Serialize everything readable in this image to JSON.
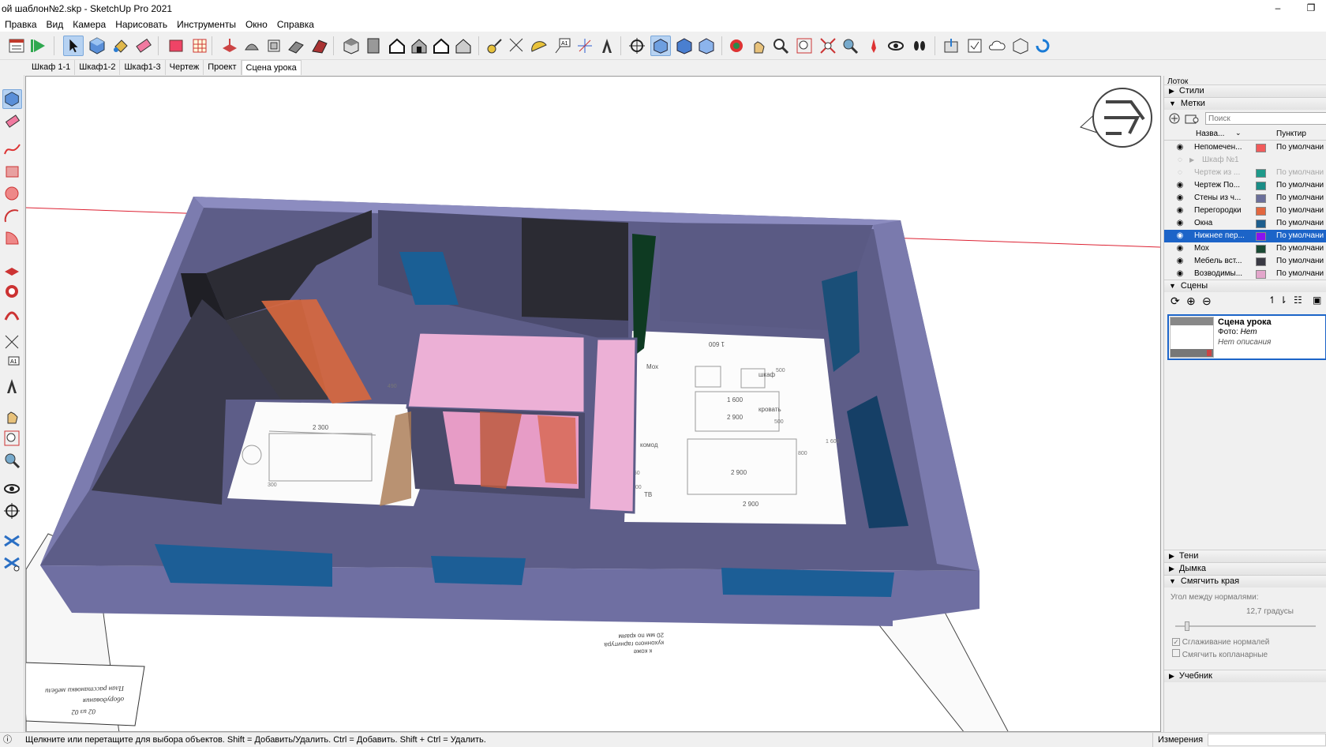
{
  "window": {
    "title": "ой шаблон№2.skp - SketchUp Pro 2021",
    "minimize": "–",
    "restore": "❐"
  },
  "menu": [
    "Правка",
    "Вид",
    "Камера",
    "Нарисовать",
    "Инструменты",
    "Окно",
    "Справка"
  ],
  "tabs": [
    "Шкаф 1-1",
    "Шкаф1-2",
    "Шкаф1-3",
    "Чертеж",
    "Проект",
    "Сцена урока"
  ],
  "active_tab": "Сцена урока",
  "drawing": {
    "dims": [
      "1 600",
      "2 900",
      "1 600",
      "2 300",
      "2 900",
      "1 600",
      "500",
      "800",
      "450",
      "490",
      "500",
      "200",
      "300"
    ],
    "labels": [
      "шкаф",
      "Мох",
      "комод",
      "ТВ",
      "кровать",
      "2 900"
    ],
    "plan_sheet": [
      "План расстановки мебели",
      "оборудования",
      "02 из 02"
    ],
    "bottom_note": [
      "20 мм по краям",
      "кухонного гарнитура",
      "к коже"
    ]
  },
  "tray": {
    "title": "Лоток",
    "sections": {
      "styles": "Стили",
      "tags": "Метки",
      "scenes": "Сцены",
      "shadows": "Тени",
      "fog": "Дымка",
      "soften": "Смягчить края",
      "tutor": "Учебник"
    },
    "search_placeholder": "Поиск",
    "col_name": "Назва...",
    "col_dash": "Пунктир",
    "tags": [
      {
        "name": "Непомечен...",
        "color": "#f15b5b",
        "dash": "По умолчани",
        "state": "normal"
      },
      {
        "name": "Шкаф №1",
        "color": "",
        "dash": "",
        "state": "dim"
      },
      {
        "name": "Чертеж из ...",
        "color": "#1e9a8a",
        "dash": "По умолчани",
        "state": "dim"
      },
      {
        "name": "Чертеж По...",
        "color": "#1a8d86",
        "dash": "По умолчани",
        "state": "normal"
      },
      {
        "name": "Стены из ч...",
        "color": "#6b6f9a",
        "dash": "По умолчани",
        "state": "normal"
      },
      {
        "name": "Перегородки",
        "color": "#e2673f",
        "dash": "По умолчани",
        "state": "normal"
      },
      {
        "name": "Окна",
        "color": "#1d5e8e",
        "dash": "По умолчани",
        "state": "normal"
      },
      {
        "name": "Нижнее пер...",
        "color": "#8a12f0",
        "dash": "По умолчани",
        "state": "selected"
      },
      {
        "name": "Мох",
        "color": "#1a4a34",
        "dash": "По умолчани",
        "state": "normal"
      },
      {
        "name": "Мебель вст...",
        "color": "#3a3a44",
        "dash": "По умолчани",
        "state": "normal"
      },
      {
        "name": "Возводимы...",
        "color": "#e3a6cb",
        "dash": "По умолчани",
        "state": "normal"
      }
    ],
    "scene": {
      "name": "Сцена урока",
      "photo_label": "Фото:",
      "photo_value": "Нет",
      "desc": "Нет описания"
    },
    "soften": {
      "angle_label": "Угол между нормалями:",
      "angle_value": "12,7 градусы",
      "smooth": "Сглаживание нормалей",
      "coplanar": "Смягчить копланарные",
      "smooth_checked": true,
      "coplanar_checked": false
    }
  },
  "status": {
    "hint": "Щелкните или перетащите для выбора объектов. Shift = Добавить/Удалить. Ctrl = Добавить. Shift + Ctrl = Удалить.",
    "measure": "Измерения"
  }
}
